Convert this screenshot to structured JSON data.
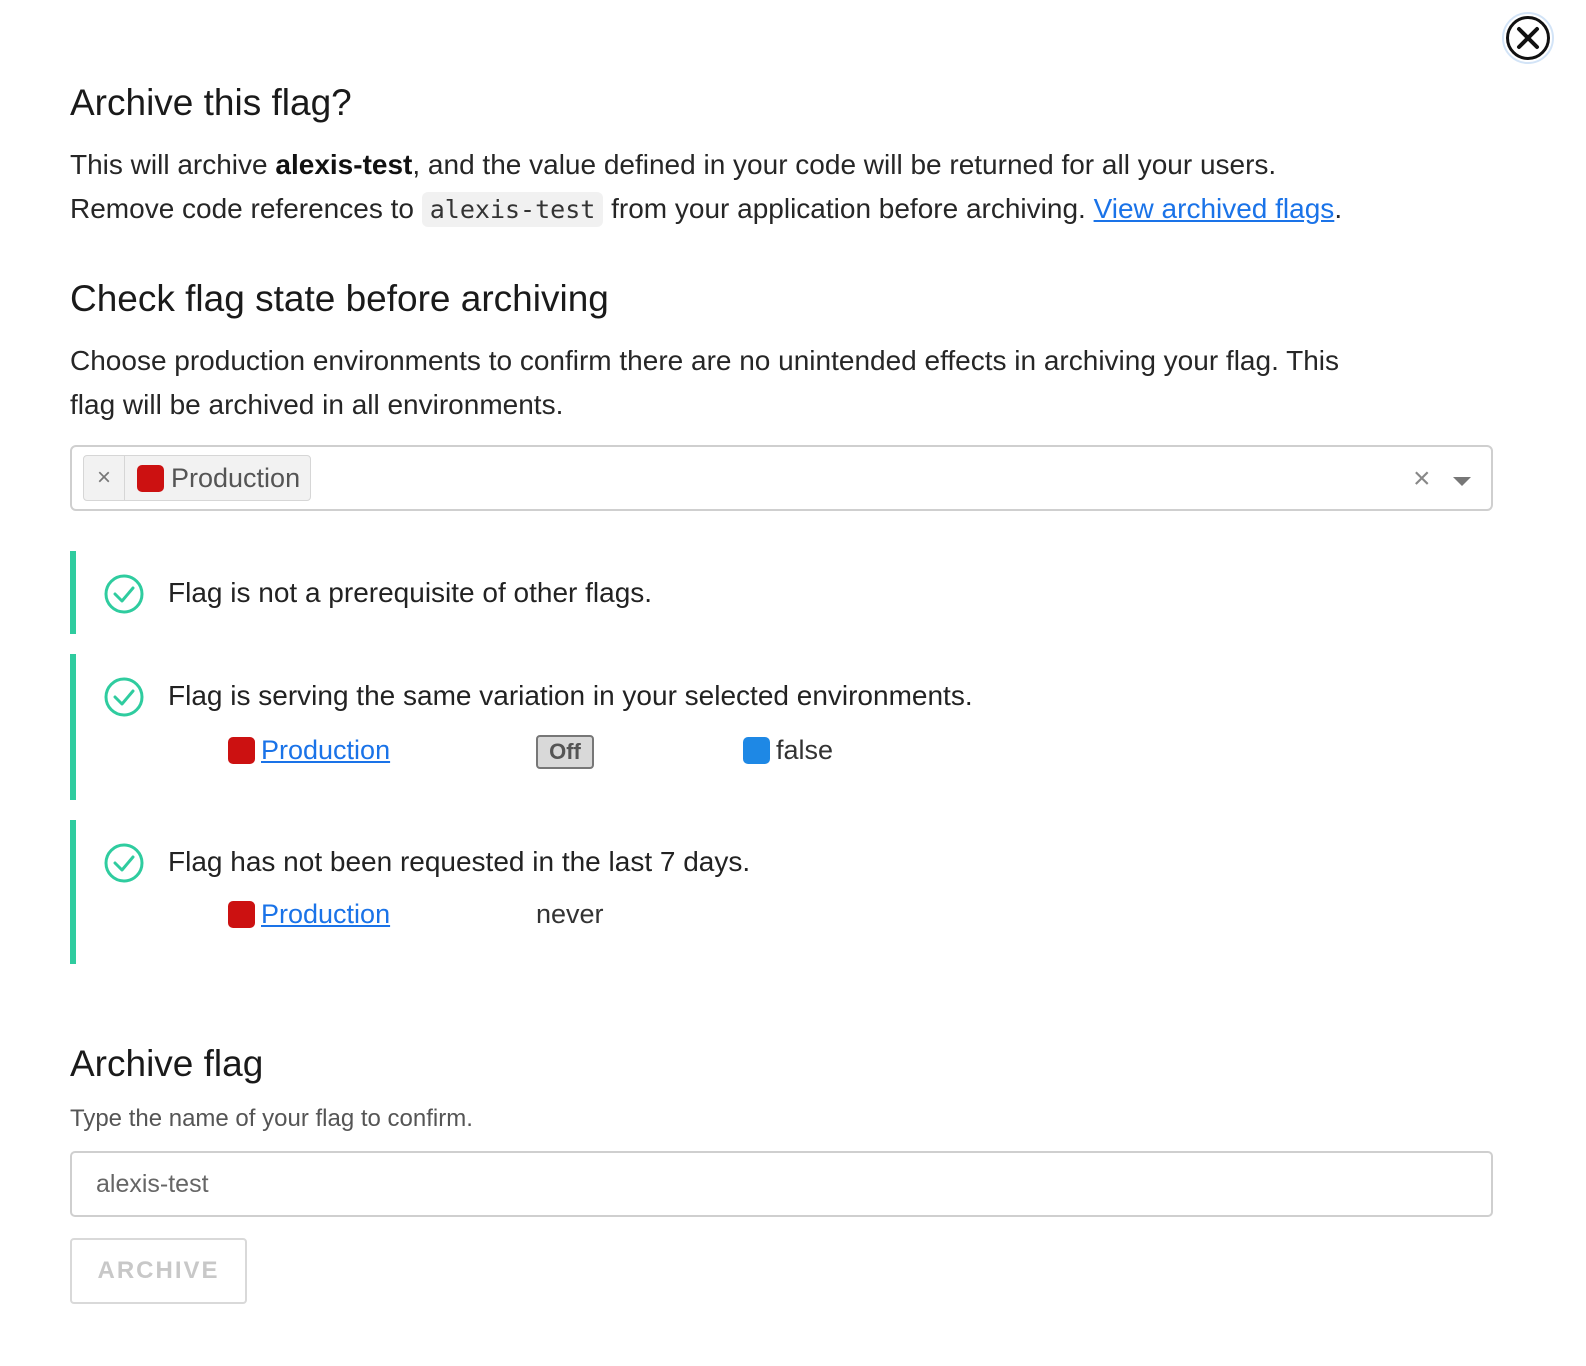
{
  "dialog": {
    "close_icon": "close-icon"
  },
  "archive_section": {
    "title": "Archive this flag?",
    "line1_prefix": "This will archive ",
    "flag_key": "alexis-test",
    "line1_suffix": ", and the value defined in your code will be returned for all your users.",
    "line2_prefix": "Remove code references to ",
    "code_ref": "alexis-test",
    "line2_middle": " from your application before archiving. ",
    "link_label": "View archived flags",
    "line2_suffix": "."
  },
  "check_section": {
    "title": "Check flag state before archiving",
    "description_line1": "Choose production environments to confirm there are no unintended effects in archiving your flag. This",
    "description_line2": "flag will be archived in all environments.",
    "env_select": {
      "selected": [
        {
          "label": "Production",
          "color": "#cc1111"
        }
      ],
      "remove_chip_glyph": "×",
      "clear_glyph": "×",
      "dropdown_icon": "chevron-down-icon"
    },
    "checks": [
      {
        "status_icon": "check-circle-icon",
        "title": "Flag is not a prerequisite of other flags."
      },
      {
        "status_icon": "check-circle-icon",
        "title": "Flag is serving the same variation in your selected environments.",
        "env": {
          "name": "Production",
          "color": "#cc1111"
        },
        "toggle_state": "Off",
        "variation": {
          "value": "false",
          "color": "#1e88e5"
        }
      },
      {
        "status_icon": "check-circle-icon",
        "title": "Flag has not been requested in the last 7 days.",
        "env": {
          "name": "Production",
          "color": "#cc1111"
        },
        "last_requested": "never"
      }
    ],
    "accent_color": "#2fcc9f"
  },
  "confirm_section": {
    "title": "Archive flag",
    "hint": "Type the name of your flag to confirm.",
    "input_placeholder": "alexis-test",
    "input_value": "",
    "button_label": "ARCHIVE"
  }
}
